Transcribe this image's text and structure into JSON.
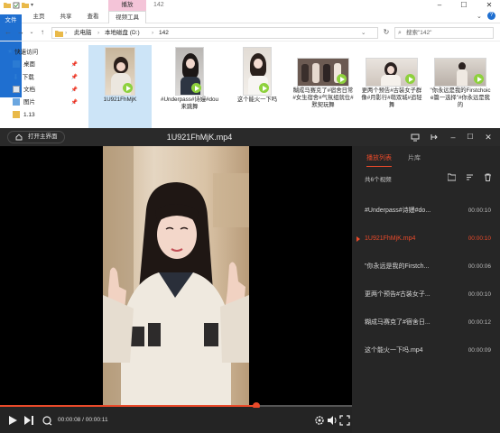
{
  "explorer": {
    "window_title": "142",
    "context_tab": "播放",
    "ribbon_tabs": [
      "文件",
      "主页",
      "共享",
      "查看",
      "视频工具"
    ],
    "breadcrumb": [
      "此电脑",
      "本地磁盘 (D:)",
      "142"
    ],
    "search_placeholder": "搜索\"142\"",
    "nav": [
      {
        "label": "快速访问",
        "icon": "star-icon"
      },
      {
        "label": "桌面",
        "icon": "desktop-folder-icon",
        "pinned": true
      },
      {
        "label": "下载",
        "icon": "download-folder-icon",
        "pinned": true
      },
      {
        "label": "文档",
        "icon": "documents-folder-icon",
        "pinned": true
      },
      {
        "label": "图片",
        "icon": "pictures-folder-icon",
        "pinned": true
      },
      {
        "label": "1.13",
        "icon": "folder-icon",
        "pinned": false
      }
    ],
    "files": [
      {
        "name": "1U921FhMjK",
        "orientation": "portrait",
        "selected": true
      },
      {
        "name": "#Underpass#诗嫚#dou来跳舞",
        "orientation": "portrait",
        "selected": false
      },
      {
        "name": "这个能火一下吗",
        "orientation": "portrait",
        "selected": false
      },
      {
        "name": "糊成马赛克了#宿舍日常#女生宿舍#气氛组就位#默契玩舞",
        "orientation": "landscape",
        "selected": false
      },
      {
        "name": "更两个预告#古装女子群像#月影行#萌双城#追轻舞",
        "orientation": "landscape",
        "selected": false
      },
      {
        "name": "\"你永远是我的Firstchoice篇一选择\"#你永远是我的",
        "orientation": "landscape",
        "selected": false
      }
    ]
  },
  "player": {
    "home_label": "打开主界面",
    "title": "1U921FhMjK.mp4",
    "progress_fraction": 0.727,
    "current_time": "00:00:08",
    "total_time": "00:00:11",
    "time_sep": " / ",
    "tabs": [
      "播放列表",
      "片库"
    ],
    "count_label": "共6个视频",
    "playlist": [
      {
        "name": "#Underpass#诗嫚#do...",
        "duration": "00:00:10",
        "current": false
      },
      {
        "name": "1U921FhMjK.mp4",
        "duration": "00:00:10",
        "current": true
      },
      {
        "name": "\"你永远是我的Firstch...",
        "duration": "00:00:06",
        "current": false
      },
      {
        "name": "更两个预告#古装女子...",
        "duration": "00:00:10",
        "current": false
      },
      {
        "name": "糊成马赛克了#宿舍日...",
        "duration": "00:00:12",
        "current": false
      },
      {
        "name": "这个能火一下吗.mp4",
        "duration": "00:00:09",
        "current": false
      }
    ]
  },
  "colors": {
    "accent": "#e94a2a",
    "file_tab": "#1f6fd0",
    "context_tab": "#f4c4d8",
    "selection": "#cce4f7"
  }
}
